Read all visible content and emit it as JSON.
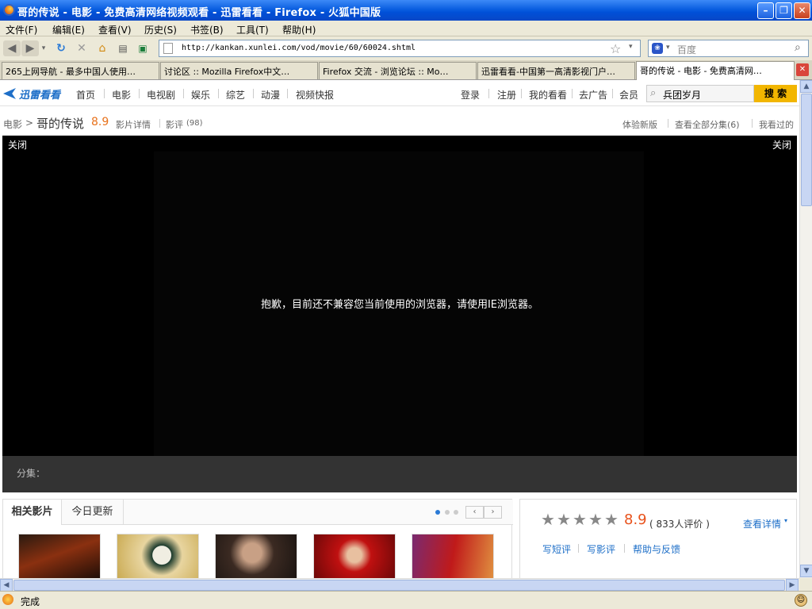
{
  "window": {
    "title": "哥的传说 - 电影 - 免费高清网络视频观看 - 迅雷看看 - Firefox - 火狐中国版"
  },
  "menu": [
    "文件(F)",
    "编辑(E)",
    "查看(V)",
    "历史(S)",
    "书签(B)",
    "工具(T)",
    "帮助(H)"
  ],
  "nav": {
    "url": "http://kankan.xunlei.com/vod/movie/60/60024.shtml",
    "search_placeholder": "百度"
  },
  "tabs": [
    {
      "label": "265上网导航 - 最多中国人使用…"
    },
    {
      "label": "讨论区 :: Mozilla Firefox中文…"
    },
    {
      "label": "Firefox 交流 - 浏览论坛 :: Mo…"
    },
    {
      "label": "迅雷看看-中国第一高清影视门户…"
    },
    {
      "label": "哥的传说 - 电影 - 免费高清网…"
    }
  ],
  "site": {
    "logo": "迅雷看看",
    "nav": [
      "首页",
      "电影",
      "电视剧",
      "娱乐",
      "综艺",
      "动漫",
      "视频快报"
    ],
    "right_links": [
      "登录",
      "注册",
      "我的看看",
      "去广告",
      "会员"
    ],
    "search_value": "兵团岁月",
    "search_button": "搜 索"
  },
  "crumb": {
    "category": "电影",
    "arrow": ">",
    "title": "哥的传说",
    "score": "8.9",
    "details": "影片详情",
    "reviews": "影评",
    "review_count": "(98)",
    "right": [
      "体验新版",
      "查看全部分集(6)",
      "我看过的"
    ]
  },
  "player": {
    "close_left": "关闭",
    "close_right": "关闭",
    "message": "抱歉，目前还不兼容您当前使用的浏览器，请使用IE浏览器。"
  },
  "episodes": {
    "label": "分集："
  },
  "related": {
    "tab1": "相关影片",
    "tab2": "今日更新"
  },
  "rating": {
    "score": "8.9",
    "count": "( 833人评价 )",
    "details": "查看详情",
    "links": [
      "写短评",
      "写影评",
      "帮助与反馈"
    ]
  },
  "status": {
    "text": "完成"
  }
}
